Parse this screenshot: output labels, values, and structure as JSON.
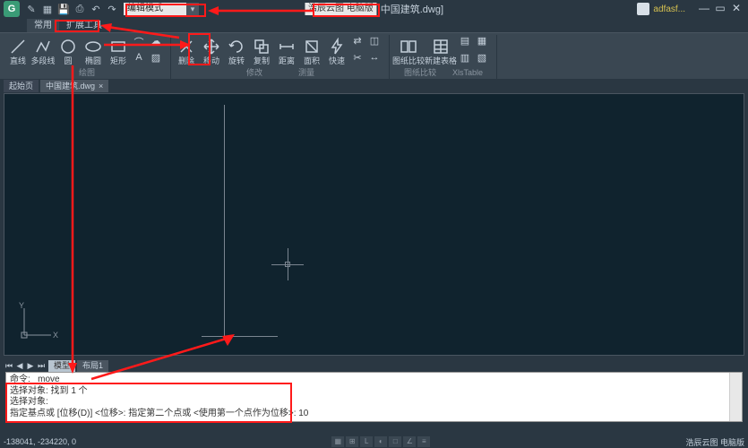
{
  "titlebar": {
    "mode_box": "编辑模式",
    "brand": "浩辰云图 电脑版",
    "filename": "中国建筑.dwg]",
    "user": "adfasf..."
  },
  "menu_tabs": [
    "常用",
    "扩展工具"
  ],
  "ribbon": {
    "groups": [
      {
        "label": "绘图",
        "tools": [
          "直线",
          "多段线",
          "圆",
          "椭圆",
          "矩形"
        ]
      },
      {
        "label": "修改",
        "tools": [
          "删除",
          "移动",
          "旋转",
          "复制",
          "距离",
          "面积",
          "快速"
        ]
      },
      {
        "label": "测量",
        "tools": [
          ""
        ]
      },
      {
        "label": "图纸比较",
        "tools": [
          "图纸比较",
          "新建表格"
        ]
      },
      {
        "label": "XlsTable",
        "tools": [
          ""
        ]
      }
    ]
  },
  "file_tabs": [
    {
      "name": "起始页"
    },
    {
      "name": "中国建筑.dwg",
      "close": "×"
    }
  ],
  "layout_tabs": [
    "模型",
    "布局1"
  ],
  "command": {
    "l1": "命令: _move",
    "l2": "选择对象: 找到 1 个",
    "l3": "选择对象:",
    "l4": "指定基点或 [位移(D)] <位移>:   指定第二个点或 <使用第一个点作为位移>: 10"
  },
  "status": {
    "coords": "-138041, -234220, 0",
    "right": "浩辰云图 电脑版"
  }
}
